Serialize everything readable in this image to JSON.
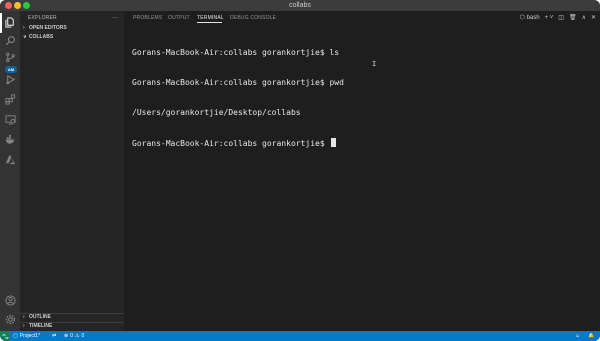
{
  "window": {
    "title": "collabs"
  },
  "sidebar": {
    "header": "EXPLORER",
    "more": "···",
    "sections": {
      "open_editors": "OPEN EDITORS",
      "collabs": "COLLABS",
      "outline": "OUTLINE",
      "timeline": "TIMELINE"
    }
  },
  "activity": {
    "liveshare_badge": "AM"
  },
  "panel": {
    "tabs": [
      "PROBLEMS",
      "OUTPUT",
      "TERMINAL",
      "DEBUG CONSOLE"
    ],
    "active_tab": "TERMINAL",
    "shell": "bash"
  },
  "terminal": {
    "lines": [
      "Gorans-MacBook-Air:collabs gorankortjie$ ls",
      "Gorans-MacBook-Air:collabs gorankortjie$ pwd",
      "/Users/gorankortjie/Desktop/collabs",
      "Gorans-MacBook-Air:collabs gorankortjie$ "
    ]
  },
  "statusbar": {
    "project": "Project1*",
    "errors": "0",
    "warnings": "0"
  },
  "colors": {
    "statusbar": "#007acc",
    "panel_bg": "#1e1e1e",
    "sidebar_bg": "#252526"
  }
}
